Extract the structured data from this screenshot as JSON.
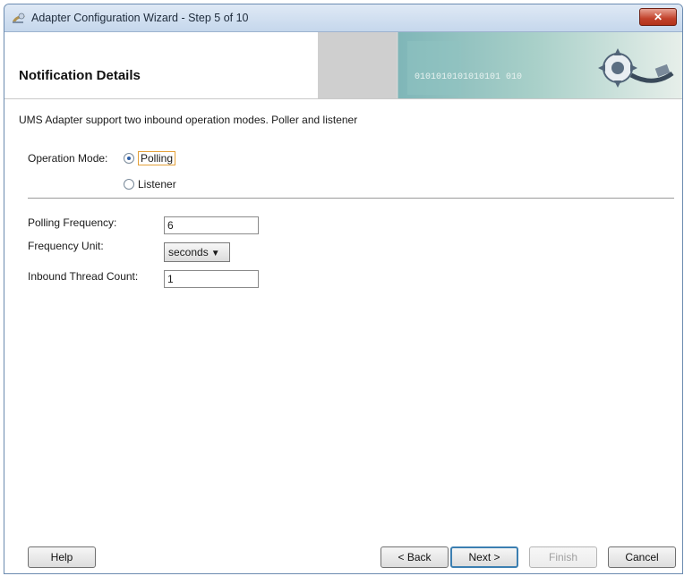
{
  "window": {
    "title": "Adapter Configuration Wizard - Step 5 of 10",
    "close_glyph": "✕"
  },
  "header": {
    "title": "Notification Details",
    "art_text": "0101010101010101 010"
  },
  "content": {
    "intro": "UMS Adapter support two inbound operation modes. Poller and listener",
    "operation_mode_label": "Operation Mode:",
    "mode_options": [
      {
        "label": "Polling",
        "checked": true
      },
      {
        "label": "Listener",
        "checked": false
      }
    ],
    "polling_frequency_label": "Polling Frequency:",
    "polling_frequency_value": "6",
    "frequency_unit_label": "Frequency Unit:",
    "frequency_unit_value": "seconds",
    "thread_count_label": "Inbound Thread Count:",
    "thread_count_value": "1"
  },
  "buttons": {
    "help": "Help",
    "back": "< Back",
    "next": "Next >",
    "finish": "Finish",
    "cancel": "Cancel"
  },
  "colors": {
    "accent": "#3c7fb1",
    "close": "#c2422b",
    "focus": "#e4a13a"
  }
}
